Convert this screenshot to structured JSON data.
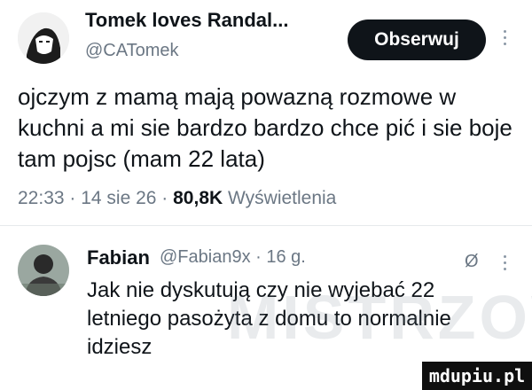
{
  "post": {
    "author_name": "Tomek loves Randal...",
    "handle": "@CATomek",
    "follow_label": "Obserwuj",
    "text": "ojczym z mamą mają powazną rozmowe w kuchni a mi sie bardzo bardzo chce pić i sie boje tam pojsc (mam 22 lata)",
    "meta_time": "22:33 · 14 sie 26 ·",
    "views_count": "80,8K",
    "views_label": "Wyświetlenia"
  },
  "reply": {
    "author_name": "Fabian",
    "handle_and_age": "@Fabian9x · 16 g.",
    "text": "Jak nie dyskutują czy nie wyjebać 22 letniego pasożyta z domu to normalnie idziesz",
    "translate_glyph": "Ø"
  },
  "watermark": {
    "text": "MISTRZOWIE"
  },
  "site_badge": {
    "text": "mdupiu.pl"
  },
  "icons": [
    "avatar-illustration",
    "more-dots-icon",
    "translate-icon"
  ],
  "colors": {
    "text": "#0f1419",
    "muted": "#6b7784",
    "button_bg": "#0f1419"
  }
}
